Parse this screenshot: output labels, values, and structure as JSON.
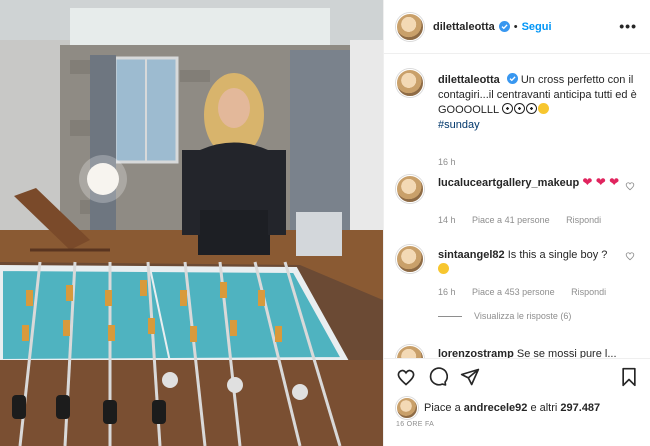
{
  "post": {
    "username": "dilettaleotta",
    "follow_label": "Segui",
    "more_label": "•••",
    "caption_user": "dilettaleotta",
    "caption_text": "Un cross perfetto con il contagiri...il centravanti anticipa tutti ed è GOOOOLLL",
    "caption_hashtag": "#sunday",
    "caption_time": "16 h"
  },
  "comments": [
    {
      "user": "lucaluceartgallery_makeup",
      "text": "",
      "emoji": "❤ ❤ ❤",
      "time": "14 h",
      "likes": "Piace a 41 persone",
      "reply": "Rispondi"
    },
    {
      "user": "sintaangel82",
      "text": "Is this a single boy ?",
      "time": "16 h",
      "likes": "Piace a 453 persone",
      "reply": "Rispondi",
      "view_replies": "Visualizza le risposte (6)"
    },
    {
      "user": "lorenzostramp",
      "text": "Se se mossi pure l..."
    }
  ],
  "footer": {
    "likes_prefix": "Piace a",
    "likes_user": "andrecele92",
    "likes_suffix": "e altri",
    "likes_count": "297.487",
    "timestamp": "16 ORE FA"
  },
  "colors": {
    "accent": "#0095f6",
    "verified": "#3897f0",
    "heart": "#ed4956",
    "muted": "#8e8e8e"
  },
  "icons": [
    "verified-badge-icon",
    "heart-icon",
    "comment-icon",
    "share-icon",
    "bookmark-icon",
    "more-options-icon"
  ]
}
